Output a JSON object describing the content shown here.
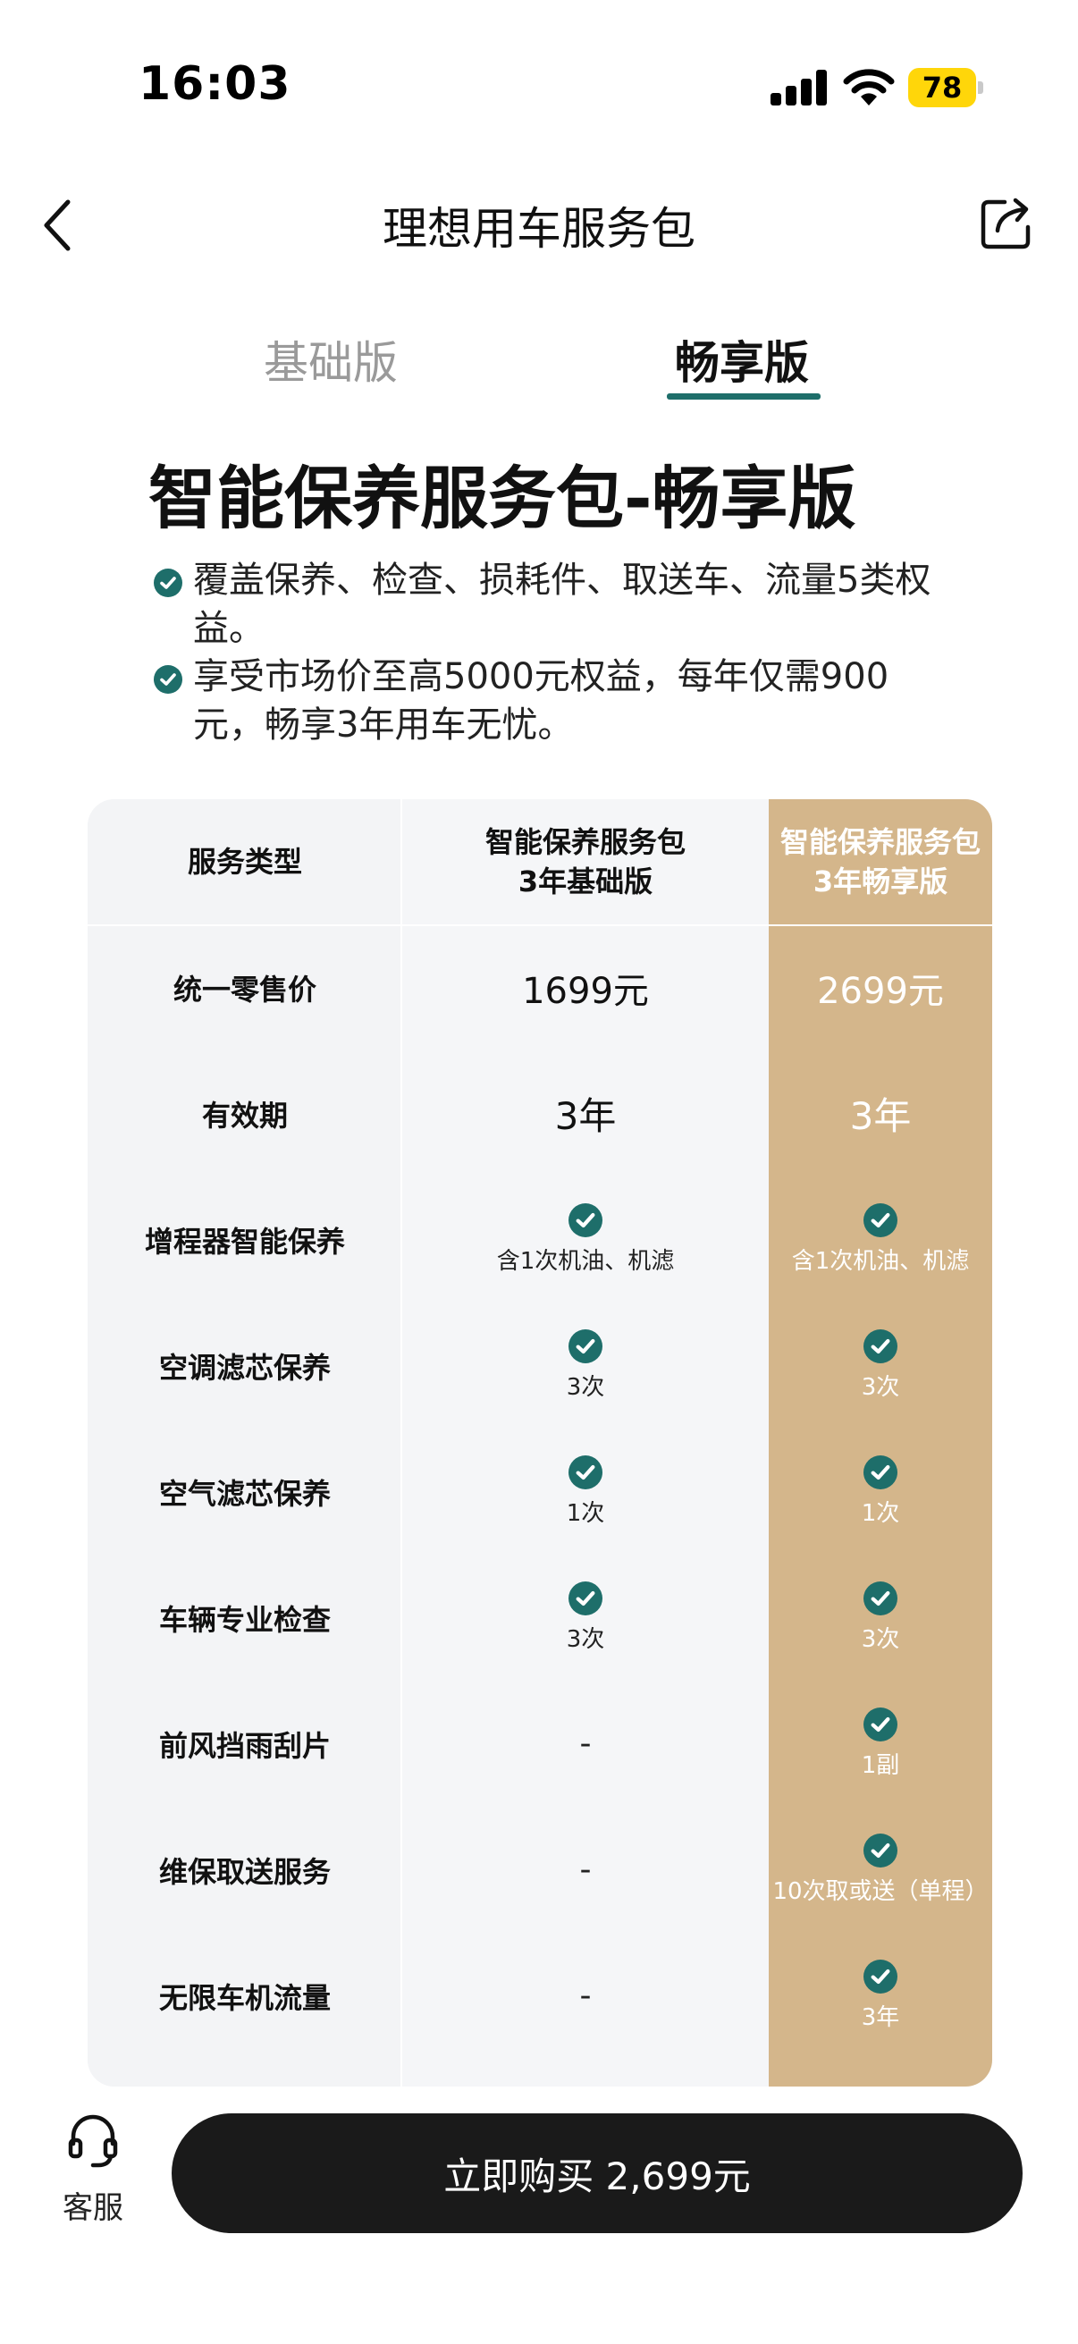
{
  "status_bar": {
    "time": "16:03",
    "battery": "78"
  },
  "nav": {
    "title": "理想用车服务包"
  },
  "tabs": [
    {
      "label": "基础版",
      "active": false
    },
    {
      "label": "畅享版",
      "active": true
    }
  ],
  "heading": "智能保养服务包-畅享版",
  "bullets": [
    "覆盖保养、检查、损耗件、取送车、流量5类权益。",
    "享受市场价至高5000元权益，每年仅需900元，畅享3年用车无忧。"
  ],
  "table": {
    "headers": {
      "type": "服务类型",
      "basic": [
        "智能保养服务包",
        "3年基础版"
      ],
      "premium": [
        "智能保养服务包",
        "3年畅享版"
      ]
    },
    "rows": [
      {
        "type": "统一零售价",
        "basic": "1699元",
        "premium": "2699元"
      },
      {
        "type": "有效期",
        "basic": "3年",
        "premium": "3年"
      },
      {
        "type": "增程器智能保养",
        "basic": "含1次机油、机滤",
        "premium": "含1次机油、机滤"
      },
      {
        "type": "空调滤芯保养",
        "basic": "3次",
        "premium": "3次"
      },
      {
        "type": "空气滤芯保养",
        "basic": "1次",
        "premium": "1次"
      },
      {
        "type": "车辆专业检查",
        "basic": "3次",
        "premium": "3次"
      },
      {
        "type": "前风挡雨刮片",
        "basic": "-",
        "premium": "1副"
      },
      {
        "type": "维保取送服务",
        "basic": "-",
        "premium": "10次取或送（单程）"
      },
      {
        "type": "无限车机流量",
        "basic": "-",
        "premium": "3年"
      }
    ]
  },
  "bottom_bar": {
    "service_label": "客服",
    "buy_label": "立即购买 2,699元"
  },
  "colors": {
    "accent": "#1e6e6a",
    "premium_column": "#d4b68b",
    "button": "#1a1a1a"
  }
}
